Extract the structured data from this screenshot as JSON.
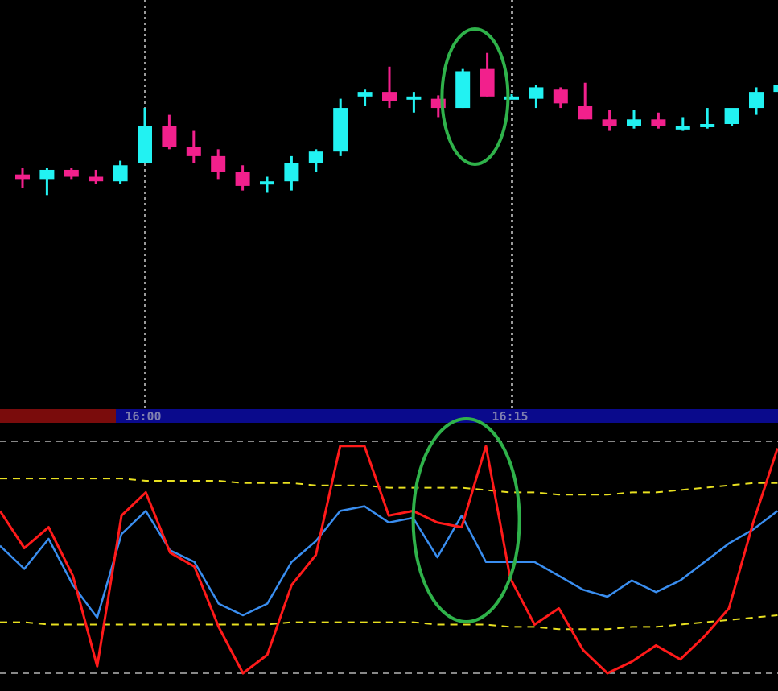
{
  "colors": {
    "background": "#000000",
    "bull": "#22f2f2",
    "bear": "#f2208c",
    "osc_fast": "#ff1a1a",
    "osc_slow": "#3a8ef0",
    "signal_band": "#e8e020",
    "level_line": "#d8d8d8",
    "time_bar_past": "#7a0c0c",
    "time_bar": "#0a0a8c",
    "marker_ring": "#2fb24a",
    "session_line": "#9a9a9a"
  },
  "time_axis": {
    "labels": [
      {
        "text": "16:00",
        "candle_index": 5
      },
      {
        "text": "16:15",
        "candle_index": 20
      }
    ]
  },
  "chart_data": [
    {
      "type": "candlestick",
      "title": "",
      "candles": [
        {
          "o": 50.0,
          "h": 50.6,
          "l": 48.8,
          "c": 49.6
        },
        {
          "o": 49.6,
          "h": 50.6,
          "l": 48.2,
          "c": 50.4
        },
        {
          "o": 50.4,
          "h": 50.6,
          "l": 49.6,
          "c": 49.8
        },
        {
          "o": 49.8,
          "h": 50.4,
          "l": 49.2,
          "c": 49.4
        },
        {
          "o": 49.4,
          "h": 51.2,
          "l": 49.2,
          "c": 50.8
        },
        {
          "o": 51.0,
          "h": 55.8,
          "l": 51.0,
          "c": 54.2
        },
        {
          "o": 54.2,
          "h": 55.2,
          "l": 52.2,
          "c": 52.4
        },
        {
          "o": 52.4,
          "h": 53.8,
          "l": 51.0,
          "c": 51.6
        },
        {
          "o": 51.6,
          "h": 52.2,
          "l": 49.6,
          "c": 50.2
        },
        {
          "o": 50.2,
          "h": 50.8,
          "l": 48.6,
          "c": 49.0
        },
        {
          "o": 49.2,
          "h": 49.8,
          "l": 48.4,
          "c": 49.4
        },
        {
          "o": 49.4,
          "h": 51.6,
          "l": 48.6,
          "c": 51.0
        },
        {
          "o": 51.0,
          "h": 52.2,
          "l": 50.2,
          "c": 52.0
        },
        {
          "o": 52.0,
          "h": 56.6,
          "l": 51.6,
          "c": 55.8
        },
        {
          "o": 56.8,
          "h": 57.4,
          "l": 56.0,
          "c": 57.2
        },
        {
          "o": 57.2,
          "h": 59.4,
          "l": 55.8,
          "c": 56.4
        },
        {
          "o": 56.8,
          "h": 57.2,
          "l": 55.4,
          "c": 56.8
        },
        {
          "o": 56.6,
          "h": 56.9,
          "l": 55.0,
          "c": 55.8
        },
        {
          "o": 55.8,
          "h": 59.2,
          "l": 55.8,
          "c": 59.0
        },
        {
          "o": 59.2,
          "h": 60.6,
          "l": 56.8,
          "c": 56.8
        },
        {
          "o": 56.8,
          "h": 57.0,
          "l": 56.6,
          "c": 56.8
        },
        {
          "o": 56.6,
          "h": 57.8,
          "l": 55.8,
          "c": 57.6
        },
        {
          "o": 57.4,
          "h": 57.6,
          "l": 55.8,
          "c": 56.2
        },
        {
          "o": 56.0,
          "h": 58.0,
          "l": 54.8,
          "c": 54.8
        },
        {
          "o": 54.8,
          "h": 55.6,
          "l": 53.8,
          "c": 54.2
        },
        {
          "o": 54.2,
          "h": 55.6,
          "l": 54.0,
          "c": 54.8
        },
        {
          "o": 54.8,
          "h": 55.4,
          "l": 54.0,
          "c": 54.2
        },
        {
          "o": 54.2,
          "h": 55.0,
          "l": 53.8,
          "c": 54.2
        },
        {
          "o": 54.2,
          "h": 55.8,
          "l": 54.0,
          "c": 54.4
        },
        {
          "o": 54.4,
          "h": 55.6,
          "l": 54.2,
          "c": 55.8
        },
        {
          "o": 55.8,
          "h": 57.6,
          "l": 55.2,
          "c": 57.2
        },
        {
          "o": 57.2,
          "h": 58.0,
          "l": 56.8,
          "c": 57.8
        }
      ],
      "highlight_candles": [
        18,
        19
      ],
      "session_separators": [
        5,
        20
      ]
    },
    {
      "type": "line",
      "title": "",
      "ylim": [
        0,
        100
      ],
      "levels": [
        100,
        0
      ],
      "x": [
        0,
        1,
        2,
        3,
        4,
        5,
        6,
        7,
        8,
        9,
        10,
        11,
        12,
        13,
        14,
        15,
        16,
        17,
        18,
        19,
        20,
        21,
        22,
        23,
        24,
        25,
        26,
        27,
        28,
        29,
        30,
        31,
        32
      ],
      "series": [
        {
          "key": "fast",
          "values": [
            70,
            54,
            63,
            42,
            3,
            68,
            78,
            52,
            46,
            20,
            0,
            8,
            38,
            51,
            98,
            98,
            68,
            70,
            65,
            63,
            98,
            41,
            21,
            28,
            10,
            0,
            5,
            12,
            6,
            16,
            28,
            65,
            97
          ]
        },
        {
          "key": "slow",
          "values": [
            55,
            45,
            58,
            38,
            24,
            60,
            70,
            53,
            48,
            30,
            25,
            30,
            48,
            57,
            70,
            72,
            65,
            67,
            50,
            68,
            48,
            48,
            48,
            42,
            36,
            33,
            40,
            35,
            40,
            48,
            56,
            62,
            70
          ]
        }
      ],
      "bands": [
        {
          "key": "upper",
          "values": [
            84,
            84,
            84,
            84,
            84,
            84,
            83,
            83,
            83,
            83,
            82,
            82,
            82,
            81,
            81,
            81,
            80,
            80,
            80,
            80,
            79,
            78,
            78,
            77,
            77,
            77,
            78,
            78,
            79,
            80,
            81,
            82,
            82
          ]
        },
        {
          "key": "lower",
          "values": [
            22,
            22,
            21,
            21,
            21,
            21,
            21,
            21,
            21,
            21,
            21,
            21,
            22,
            22,
            22,
            22,
            22,
            22,
            21,
            21,
            21,
            20,
            20,
            19,
            19,
            19,
            20,
            20,
            21,
            22,
            23,
            24,
            25
          ]
        }
      ],
      "highlight_index": 18
    }
  ]
}
